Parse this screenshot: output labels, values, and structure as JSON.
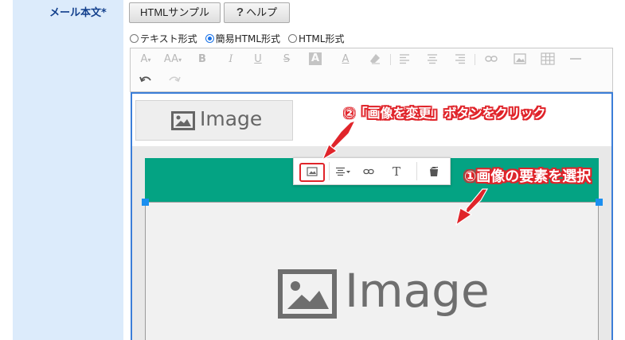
{
  "form": {
    "field_label": "メール本文*",
    "sample_button": "HTMLサンプル",
    "help_button": "ヘルプ",
    "help_prefix": "?"
  },
  "format_options": [
    {
      "label": "テキスト形式",
      "selected": false
    },
    {
      "label": "簡易HTML形式",
      "selected": true
    },
    {
      "label": "HTML形式",
      "selected": false
    }
  ],
  "toolbar": {
    "font_color": "A",
    "font_size": "AA",
    "bold": "B",
    "italic": "I",
    "underline": "U",
    "strike": "S",
    "bg_color": "A",
    "text_color": "A"
  },
  "editor": {
    "small_image_text": "Image",
    "large_image_text": "Image"
  },
  "floating_toolbar": {
    "text_tool": "T"
  },
  "annotations": {
    "step2": "②「画像を変更」ボタンをクリック",
    "step1": "①画像の要素を選択"
  },
  "colors": {
    "label_bg": "#dcebfb",
    "label_text": "#123f8c",
    "editor_border": "#3b7ed8",
    "green_bar": "#04a383",
    "handle": "#1b8ff0",
    "annotation": "#e0242a"
  }
}
